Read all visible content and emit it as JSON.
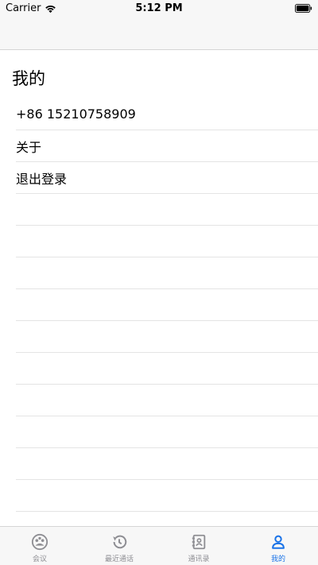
{
  "status_bar": {
    "carrier": "Carrier",
    "time": "5:12 PM"
  },
  "page": {
    "title": "我的"
  },
  "menu": {
    "items": [
      {
        "label": "+86 15210758909"
      },
      {
        "label": "关于"
      },
      {
        "label": "退出登录"
      }
    ]
  },
  "tab_bar": {
    "items": [
      {
        "label": "会议",
        "icon": "meeting-icon"
      },
      {
        "label": "最近通话",
        "icon": "history-icon"
      },
      {
        "label": "通讯录",
        "icon": "contacts-icon"
      },
      {
        "label": "我的",
        "icon": "person-icon"
      }
    ],
    "active_color": "#1a73e8",
    "inactive_color": "#8e8e93"
  }
}
